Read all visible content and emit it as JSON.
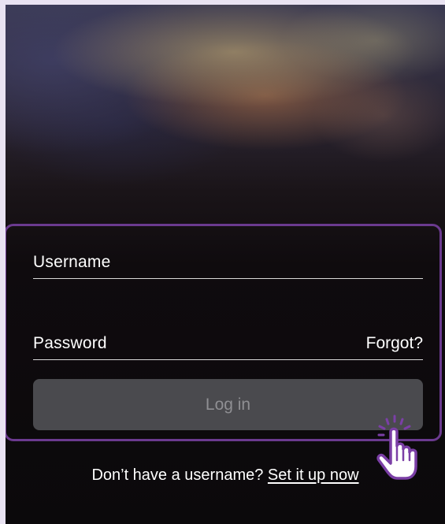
{
  "login_form": {
    "username_label": "Username",
    "password_label": "Password",
    "forgot_link": "Forgot?",
    "login_button": "Log in"
  },
  "signup": {
    "prompt": "Don’t have a username?",
    "link": "Set it up now"
  },
  "colors": {
    "highlight_border": "#6b3a8f",
    "button_bg": "#4a4a4e",
    "button_text": "#8f8f93",
    "cursor_accent": "#7b3fa6"
  },
  "icons": {
    "cursor": "pointer-hand-icon"
  }
}
